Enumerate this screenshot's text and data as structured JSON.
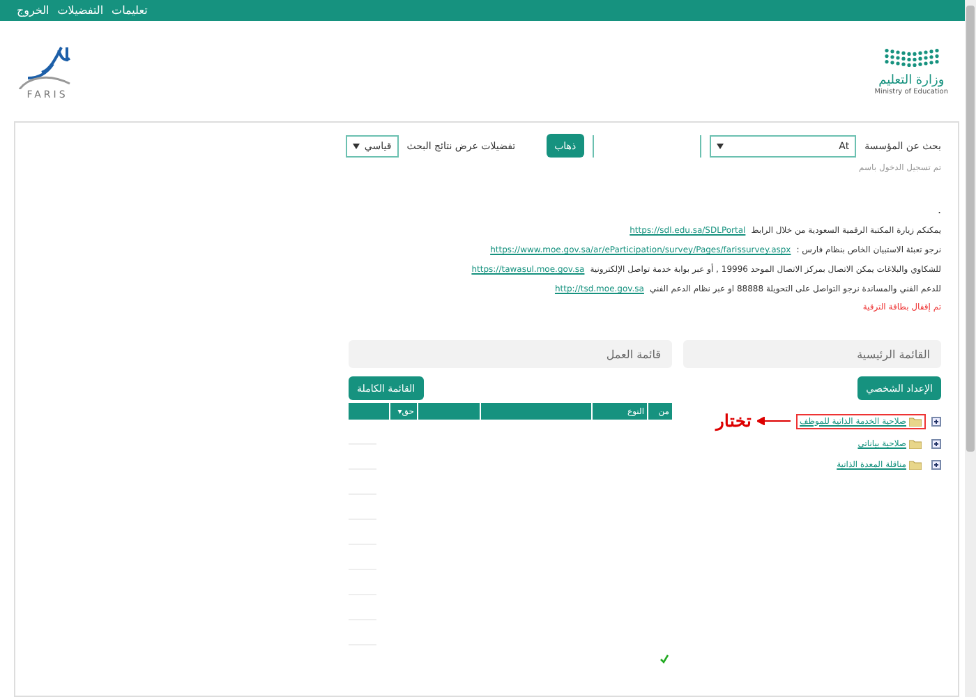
{
  "top_bar": {
    "links": [
      "تعليمات",
      "التفضيلات",
      "الخروج"
    ]
  },
  "header": {
    "ministry_name": "وزارة التعليم",
    "ministry_subtitle": "Ministry of Education",
    "logo_text": "FARIS"
  },
  "search": {
    "label": "بحث عن المؤسسة",
    "institution_value": "At",
    "go_button": "ذهاب",
    "preferences_label": "تفضيلات عرض نتائج البحث",
    "preferences_value": "قياسي"
  },
  "login_note": "تم تسجيل الدخول باسم",
  "separator_dot": ".",
  "notices": [
    {
      "text": "يمكنكم زيارة المكتبة الرقمية السعودية من خلال الرابط",
      "link": "https://sdl.edu.sa/SDLPortal"
    },
    {
      "text": "نرجو تعبئة الاستبيان الخاص بنظام فارس :",
      "link": "https://www.moe.gov.sa/ar/eParticipation/survey/Pages/farissurvey.aspx"
    },
    {
      "text": "للشكاوي والبلاغات يمكن الاتصال بمركز الاتصال الموحد 19996 , أو عبر بوابة خدمة تواصل الإلكترونية",
      "link": "https://tawasul.moe.gov.sa"
    },
    {
      "text": "للدعم الفني والمساندة نرجو التواصل على التحويلة 88888 او عبر نظام الدعم الفني",
      "link": "http://tsd.moe.gov.sa"
    }
  ],
  "alert": "تم إقفال بطاقة الترقية",
  "main_menu": {
    "title": "القائمة الرئيسية",
    "button": "الإعداد الشخصي",
    "annotation": "تختار",
    "items": [
      {
        "label": "صلاحية الخدمة الذاتية للموظف",
        "expanded": false,
        "highlighted": true
      },
      {
        "label": "صلاحية بياناتي",
        "expanded": false,
        "highlighted": false
      },
      {
        "label": "مناقلة المعدة الذاتية",
        "expanded": false,
        "highlighted": false
      }
    ]
  },
  "work_list": {
    "title": "قائمة العمل",
    "button": "القائمة الكاملة",
    "columns": [
      "من",
      "النوع",
      "",
      "",
      "حق▾"
    ]
  }
}
